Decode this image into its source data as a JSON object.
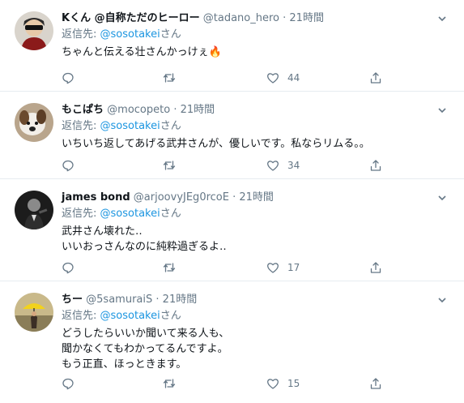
{
  "tweets": [
    {
      "name": "Kくん @自称ただのヒーロー",
      "handle": "@tadano_hero",
      "dot": "·",
      "time": "21時間",
      "reply_prefix": "返信先: ",
      "reply_mention": "@sosotakei",
      "reply_suffix": "さん",
      "body": [
        "ちゃんと伝える壮さんかっけぇ🔥"
      ],
      "likes": "44"
    },
    {
      "name": "もこぱち",
      "handle": "@mocopeto",
      "dot": "·",
      "time": "21時間",
      "reply_prefix": "返信先: ",
      "reply_mention": "@sosotakei",
      "reply_suffix": "さん",
      "body": [
        "いちいち返してあげる武井さんが、優しいです。私ならリムる。。"
      ],
      "likes": "34"
    },
    {
      "name": "james bond",
      "handle": "@arjoovyJEg0rcoE",
      "dot": "·",
      "time": "21時間",
      "reply_prefix": "返信先: ",
      "reply_mention": "@sosotakei",
      "reply_suffix": "さん",
      "body": [
        "武井さん壊れた‥",
        "いいおっさんなのに純粋過ぎるよ‥"
      ],
      "likes": "17"
    },
    {
      "name": "ちー",
      "handle": "@5samuraiS",
      "dot": "·",
      "time": "21時間",
      "reply_prefix": "返信先: ",
      "reply_mention": "@sosotakei",
      "reply_suffix": "さん",
      "body": [
        "どうしたらいいか聞いて来る人も、",
        "聞かなくてもわかってるんですよ。",
        "もう正直、ほっときます。"
      ],
      "likes": "15"
    }
  ],
  "icons": {
    "reply": "reply-icon",
    "retweet": "retweet-icon",
    "like": "heart-icon",
    "share": "share-icon",
    "more": "chevron-down-icon"
  },
  "colors": {
    "link": "#1b95e0",
    "muted": "#657786",
    "divider": "#e6ecf0"
  }
}
